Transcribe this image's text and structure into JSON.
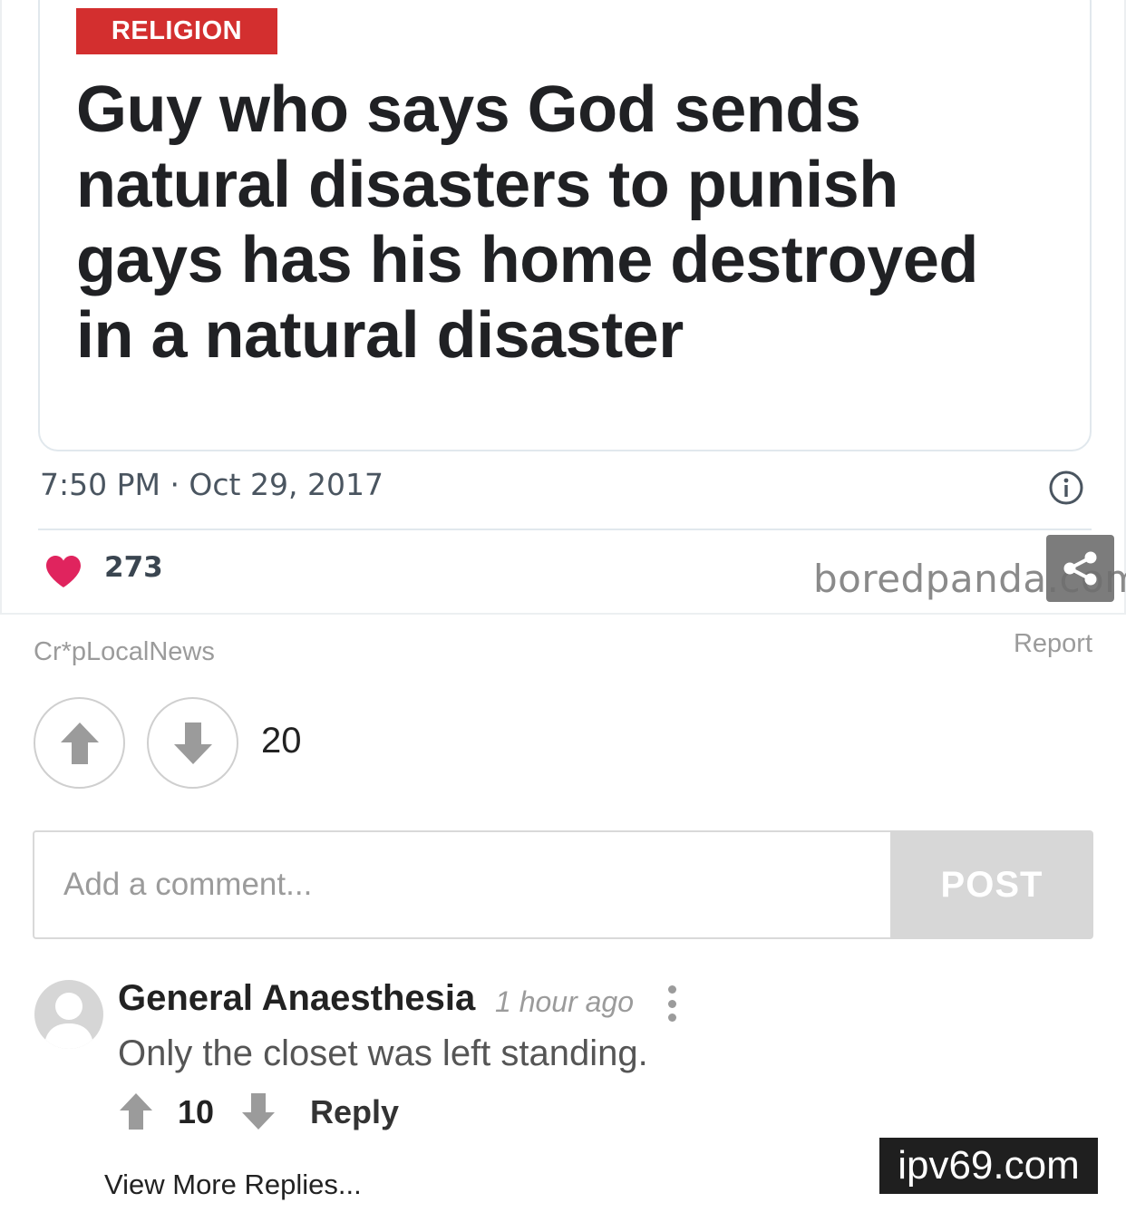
{
  "post": {
    "category": "RELIGION",
    "headline": "Guy who says God sends natural disasters to punish gays has his home destroyed in a natural disaster",
    "timestamp": "7:50 PM · Oct 29, 2017",
    "likes": "273",
    "watermark": "boredpanda.com",
    "icons": [
      "info-icon",
      "heart-icon",
      "share-icon"
    ],
    "colors": {
      "category_badge": "#d32f2f",
      "heart": "#e0245e"
    }
  },
  "source": {
    "name": "Cr*pLocalNews",
    "report_label": "Report"
  },
  "voting": {
    "score": "20"
  },
  "comment_form": {
    "placeholder": "Add a comment...",
    "post_label": "POST"
  },
  "comments": [
    {
      "author": "General Anaesthesia",
      "time": "1 hour ago",
      "text": "Only the closet was left standing.",
      "votes": "10",
      "reply_label": "Reply"
    }
  ],
  "view_more_label": "View More Replies...",
  "site_watermark": "ipv69.com"
}
